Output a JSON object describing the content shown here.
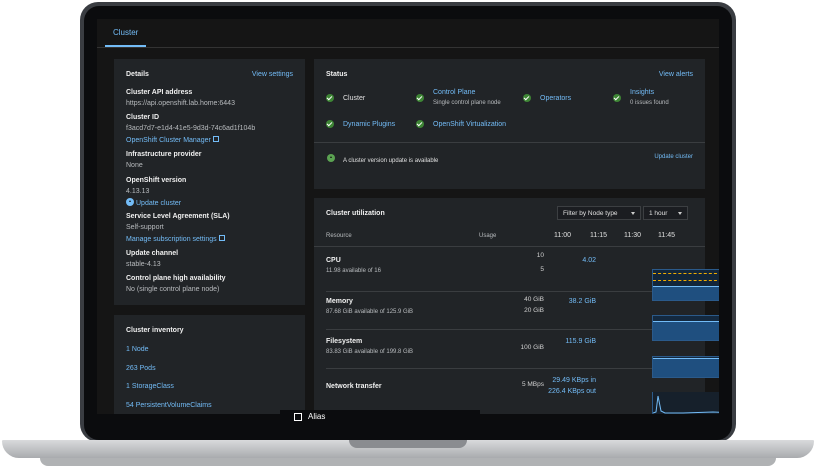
{
  "tab": {
    "label": "Cluster"
  },
  "details": {
    "title": "Details",
    "view_settings": "View settings",
    "api_label": "Cluster API address",
    "api_value": "https://api.openshift.lab.home:6443",
    "id_label": "Cluster ID",
    "id_value": "f3acd7d7-e1d4-41e5-9d3d-74c6ad1f104b",
    "ocm_link": "OpenShift Cluster Manager",
    "infra_label": "Infrastructure provider",
    "infra_value": "None",
    "version_label": "OpenShift version",
    "version_value": "4.13.13",
    "update_link": "Update cluster",
    "sla_label": "Service Level Agreement (SLA)",
    "sla_value": "Self-support",
    "manage_link": "Manage subscription settings",
    "channel_label": "Update channel",
    "channel_value": "stable-4.13",
    "ha_label": "Control plane high availability",
    "ha_value": "No (single control plane node)"
  },
  "inventory": {
    "title": "Cluster inventory",
    "items": [
      "1 Node",
      "263 Pods",
      "1 StorageClass",
      "54 PersistentVolumeClaims"
    ]
  },
  "status": {
    "title": "Status",
    "view_alerts": "View alerts",
    "items": [
      {
        "label": "Cluster",
        "sub": ""
      },
      {
        "label": "Control Plane",
        "sub": "Single control plane node"
      },
      {
        "label": "Operators",
        "sub": ""
      },
      {
        "label": "Insights",
        "sub": "0 issues found"
      },
      {
        "label": "Dynamic Plugins",
        "sub": ""
      },
      {
        "label": "OpenShift Virtualization",
        "sub": ""
      }
    ],
    "update_msg": "A cluster version update is available",
    "update_link": "Update cluster",
    "status_color": "#3e8635"
  },
  "utilization": {
    "title": "Cluster utilization",
    "filter": "Filter by Node type",
    "range": "1 hour",
    "col_resource": "Resource",
    "col_usage": "Usage",
    "times": [
      "11:00",
      "11:15",
      "11:30",
      "11:45"
    ],
    "rows": [
      {
        "name": "CPU",
        "sub": "11.98 available of 16",
        "usage": "4.02",
        "usage2": "",
        "ticks": [
          "10",
          "5"
        ]
      },
      {
        "name": "Memory",
        "sub": "87.68 GiB available of 125.9 GiB",
        "usage": "38.2 GiB",
        "usage2": "",
        "ticks": [
          "40 GiB",
          "20 GiB"
        ]
      },
      {
        "name": "Filesystem",
        "sub": "83.83 GiB available of 199.8 GiB",
        "usage": "115.9 GiB",
        "usage2": "",
        "ticks": [
          "100 GiB"
        ]
      },
      {
        "name": "Network transfer",
        "sub": "",
        "usage": "29.49 KBps in",
        "usage2": "226.4 KBps out",
        "ticks": [
          "5 MBps"
        ]
      }
    ]
  },
  "alias": {
    "label": "Alias"
  },
  "colors": {
    "accent": "#73bcf7",
    "card": "#212427",
    "background": "#151515",
    "success": "#3e8635",
    "limit_line": "#f0ab00"
  }
}
